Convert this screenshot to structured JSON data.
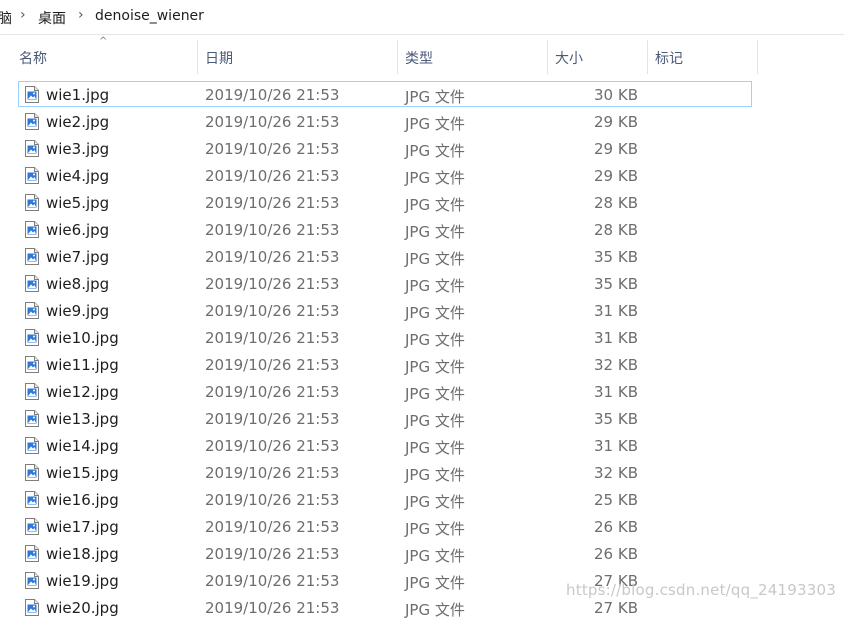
{
  "breadcrumb": {
    "cut_root": "脑",
    "items": [
      "桌面",
      "denoise_wiener"
    ]
  },
  "columns": {
    "name": "名称",
    "date": "日期",
    "type": "类型",
    "size": "大小",
    "tag": "标记"
  },
  "files": [
    {
      "name": "wie1.jpg",
      "date": "2019/10/26 21:53",
      "type": "JPG 文件",
      "size": "30 KB"
    },
    {
      "name": "wie2.jpg",
      "date": "2019/10/26 21:53",
      "type": "JPG 文件",
      "size": "29 KB"
    },
    {
      "name": "wie3.jpg",
      "date": "2019/10/26 21:53",
      "type": "JPG 文件",
      "size": "29 KB"
    },
    {
      "name": "wie4.jpg",
      "date": "2019/10/26 21:53",
      "type": "JPG 文件",
      "size": "29 KB"
    },
    {
      "name": "wie5.jpg",
      "date": "2019/10/26 21:53",
      "type": "JPG 文件",
      "size": "28 KB"
    },
    {
      "name": "wie6.jpg",
      "date": "2019/10/26 21:53",
      "type": "JPG 文件",
      "size": "28 KB"
    },
    {
      "name": "wie7.jpg",
      "date": "2019/10/26 21:53",
      "type": "JPG 文件",
      "size": "35 KB"
    },
    {
      "name": "wie8.jpg",
      "date": "2019/10/26 21:53",
      "type": "JPG 文件",
      "size": "35 KB"
    },
    {
      "name": "wie9.jpg",
      "date": "2019/10/26 21:53",
      "type": "JPG 文件",
      "size": "31 KB"
    },
    {
      "name": "wie10.jpg",
      "date": "2019/10/26 21:53",
      "type": "JPG 文件",
      "size": "31 KB"
    },
    {
      "name": "wie11.jpg",
      "date": "2019/10/26 21:53",
      "type": "JPG 文件",
      "size": "32 KB"
    },
    {
      "name": "wie12.jpg",
      "date": "2019/10/26 21:53",
      "type": "JPG 文件",
      "size": "31 KB"
    },
    {
      "name": "wie13.jpg",
      "date": "2019/10/26 21:53",
      "type": "JPG 文件",
      "size": "35 KB"
    },
    {
      "name": "wie14.jpg",
      "date": "2019/10/26 21:53",
      "type": "JPG 文件",
      "size": "31 KB"
    },
    {
      "name": "wie15.jpg",
      "date": "2019/10/26 21:53",
      "type": "JPG 文件",
      "size": "32 KB"
    },
    {
      "name": "wie16.jpg",
      "date": "2019/10/26 21:53",
      "type": "JPG 文件",
      "size": "25 KB"
    },
    {
      "name": "wie17.jpg",
      "date": "2019/10/26 21:53",
      "type": "JPG 文件",
      "size": "26 KB"
    },
    {
      "name": "wie18.jpg",
      "date": "2019/10/26 21:53",
      "type": "JPG 文件",
      "size": "26 KB"
    },
    {
      "name": "wie19.jpg",
      "date": "2019/10/26 21:53",
      "type": "JPG 文件",
      "size": "27 KB"
    },
    {
      "name": "wie20.jpg",
      "date": "2019/10/26 21:53",
      "type": "JPG 文件",
      "size": "27 KB"
    }
  ],
  "selected_index": 0,
  "watermark": "https://blog.csdn.net/qq_24193303",
  "colors": {
    "selection_border": "#99d1ff",
    "header_text": "#4b5a78",
    "icon_blue": "#2f7ad8"
  }
}
